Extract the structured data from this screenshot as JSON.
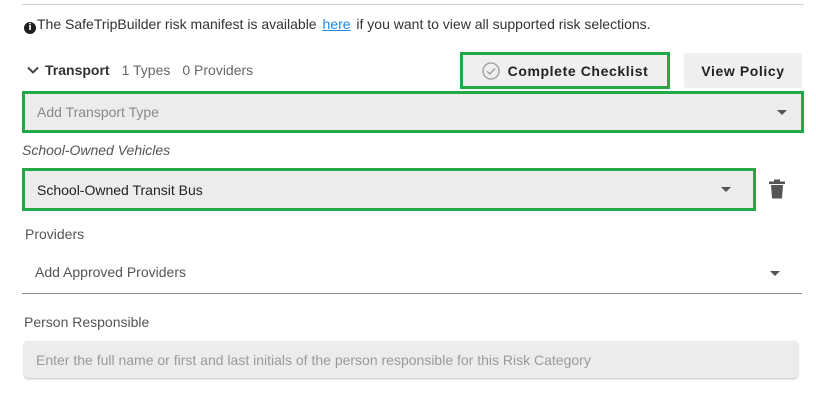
{
  "notice": {
    "text_before": "The SafeTripBuilder risk manifest is available ",
    "link_text": "here",
    "text_after": " if you want to view all supported risk selections."
  },
  "section": {
    "title": "Transport",
    "types_count": "1 Types",
    "providers_count": "0 Providers"
  },
  "buttons": {
    "complete_checklist": "Complete Checklist",
    "view_policy": "View Policy"
  },
  "transport_type_select": {
    "placeholder": "Add Transport Type"
  },
  "vehicle_group": {
    "label": "School-Owned Vehicles",
    "selected_value": "School-Owned Transit Bus"
  },
  "providers": {
    "label": "Providers",
    "placeholder": "Add Approved Providers"
  },
  "person_responsible": {
    "label": "Person Responsible",
    "placeholder": "Enter the full name or first and last initials of the person responsible for this Risk Category"
  },
  "colors": {
    "highlight_border": "#22a845",
    "link": "#1e88e5",
    "field_background": "#ececec"
  }
}
